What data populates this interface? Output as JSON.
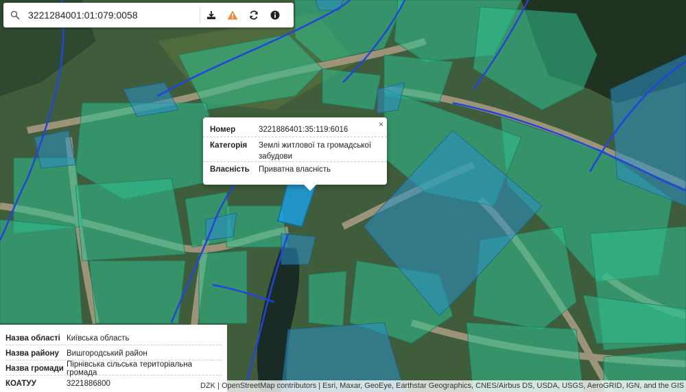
{
  "search": {
    "value": "3221284001:01:079:0058",
    "icon": "search-icon",
    "tools": [
      "download-icon",
      "warning-icon",
      "refresh-icon",
      "info-icon"
    ]
  },
  "colors": {
    "parcel_green": "#2fbf8f",
    "parcel_blue": "#2a8fc9",
    "highlight_blue": "#1aa3e8",
    "boundary_line": "#2244dd"
  },
  "popup": {
    "close_label": "×",
    "rows": [
      {
        "key": "Номер",
        "value": "3221886401:35:119:6016"
      },
      {
        "key": "Категорія",
        "value": "Землі житлової та громадської забудови"
      },
      {
        "key": "Власність",
        "value": "Приватна власність"
      }
    ]
  },
  "info_panel": {
    "rows": [
      {
        "key": "Назва області",
        "value": "Київська область"
      },
      {
        "key": "Назва району",
        "value": "Вишгородський район"
      },
      {
        "key": "Назва громади",
        "value": "Пірнівська сільська територіальна громада"
      },
      {
        "key": "КОАТУУ",
        "value": "3221886800"
      }
    ]
  },
  "attribution": "DZK | OpenStreetMap contributors | Esri, Maxar, GeoEye, Earthstar Geographics, CNES/Airbus DS, USDA, USGS, AeroGRID, IGN, and the GIS User Community"
}
